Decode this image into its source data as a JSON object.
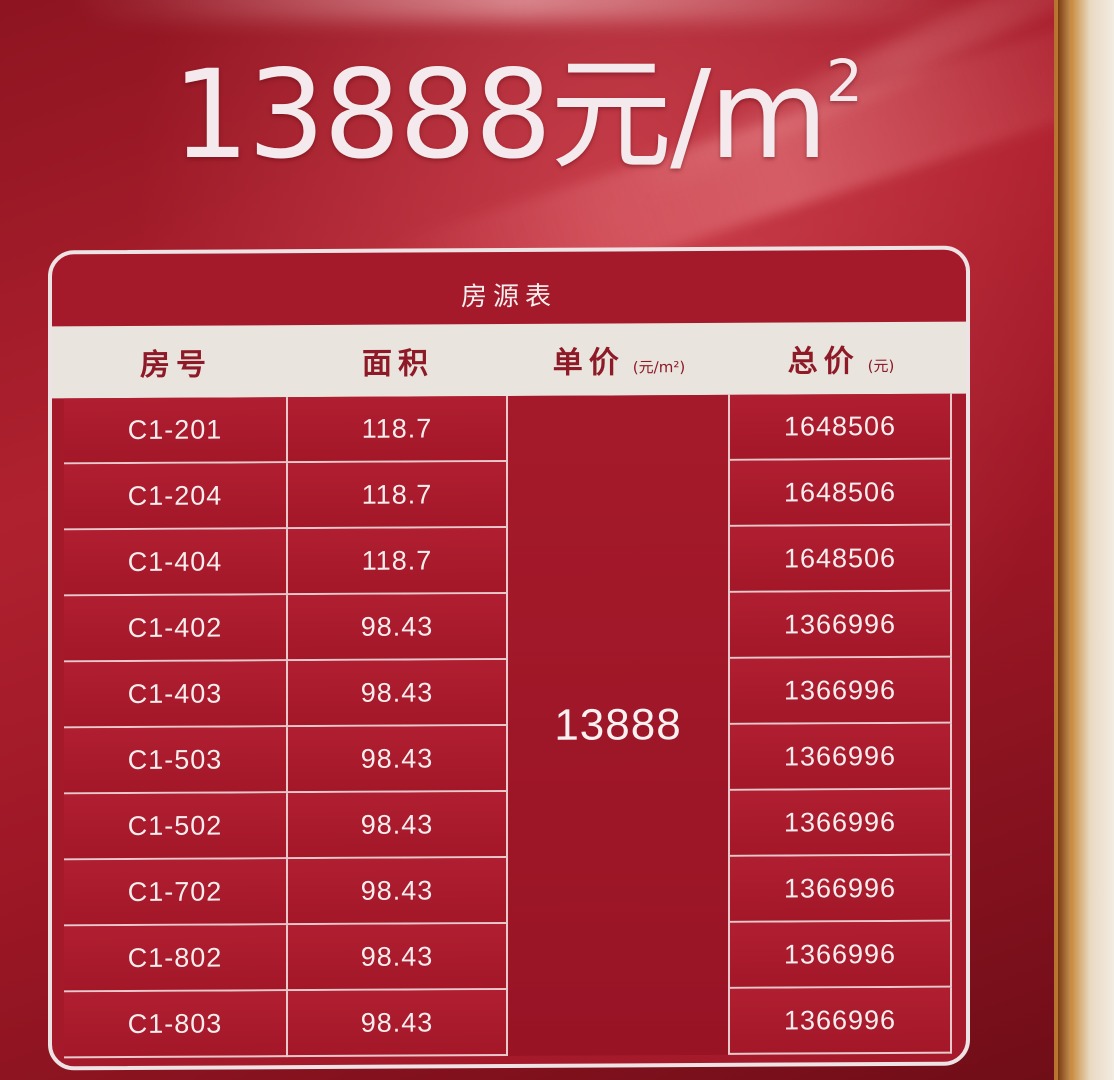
{
  "headline": {
    "price": "13888元/m",
    "sup": "2"
  },
  "table": {
    "caption": "房源表",
    "headers": {
      "room": "房号",
      "area": "面积",
      "unit_price": "单价",
      "unit_price_unit": "(元/m²)",
      "total": "总价",
      "total_unit": "(元)"
    },
    "unit_price_value": "13888",
    "rows": [
      {
        "room": "C1-201",
        "area": "118.7",
        "total": "1648506"
      },
      {
        "room": "C1-204",
        "area": "118.7",
        "total": "1648506"
      },
      {
        "room": "C1-404",
        "area": "118.7",
        "total": "1648506"
      },
      {
        "room": "C1-402",
        "area": "98.43",
        "total": "1366996"
      },
      {
        "room": "C1-403",
        "area": "98.43",
        "total": "1366996"
      },
      {
        "room": "C1-503",
        "area": "98.43",
        "total": "1366996"
      },
      {
        "room": "C1-502",
        "area": "98.43",
        "total": "1366996"
      },
      {
        "room": "C1-702",
        "area": "98.43",
        "total": "1366996"
      },
      {
        "room": "C1-802",
        "area": "98.43",
        "total": "1366996"
      },
      {
        "room": "C1-803",
        "area": "98.43",
        "total": "1366996"
      }
    ]
  }
}
